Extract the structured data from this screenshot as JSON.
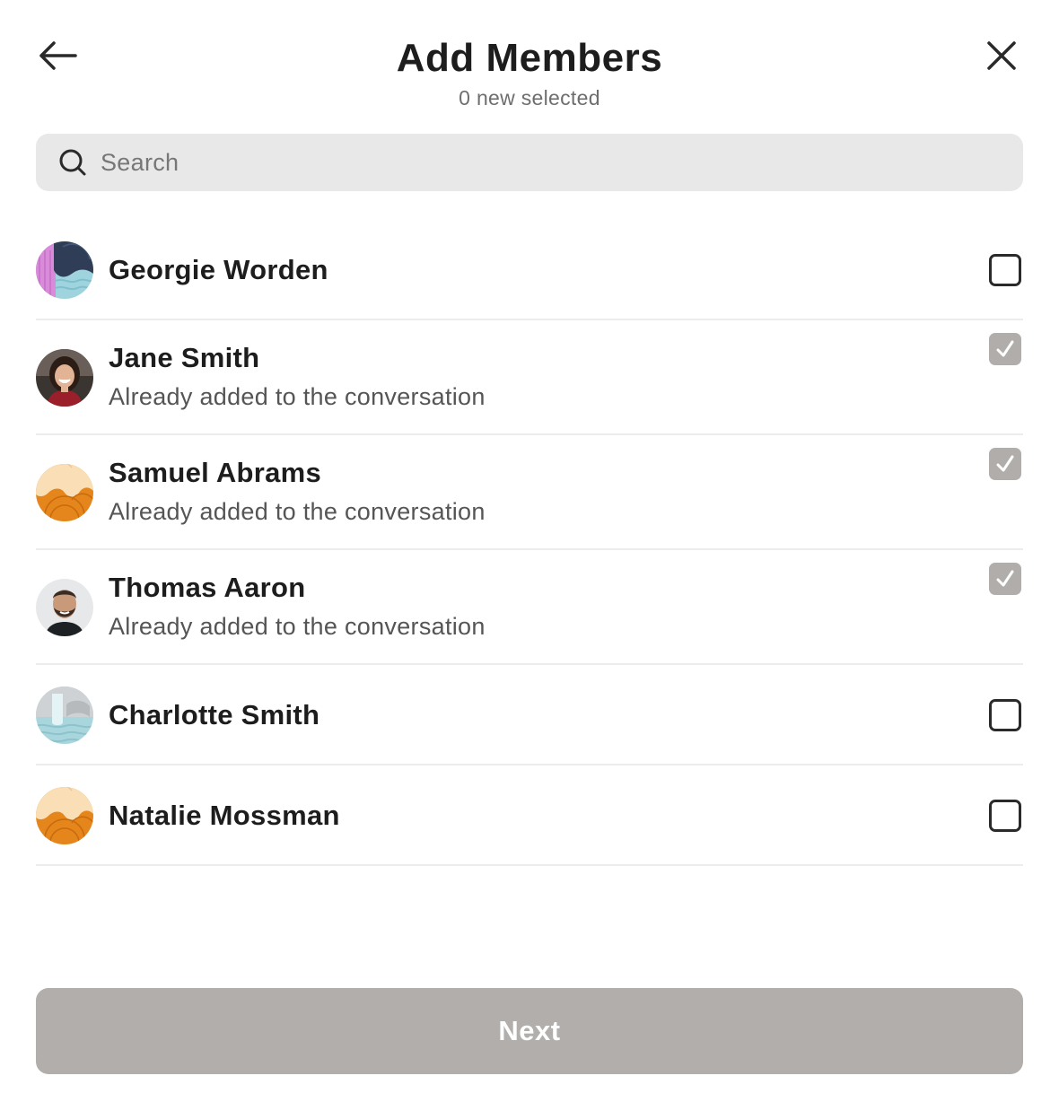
{
  "header": {
    "title": "Add Members",
    "subtitle": "0 new selected"
  },
  "search": {
    "placeholder": "Search",
    "value": ""
  },
  "members": [
    {
      "name": "Georgie Worden",
      "status": "",
      "checked": false,
      "disabled": false,
      "avatar": "pattern-pink-navy"
    },
    {
      "name": "Jane Smith",
      "status": "Already added to the conversation",
      "checked": true,
      "disabled": true,
      "avatar": "photo-woman"
    },
    {
      "name": "Samuel Abrams",
      "status": "Already added to the conversation",
      "checked": true,
      "disabled": true,
      "avatar": "pattern-orange"
    },
    {
      "name": "Thomas Aaron",
      "status": "Already added to the conversation",
      "checked": true,
      "disabled": true,
      "avatar": "photo-man"
    },
    {
      "name": "Charlotte Smith",
      "status": "",
      "checked": false,
      "disabled": false,
      "avatar": "pattern-light-blue"
    },
    {
      "name": "Natalie Mossman",
      "status": "",
      "checked": false,
      "disabled": false,
      "avatar": "pattern-orange"
    }
  ],
  "footer": {
    "next_label": "Next",
    "next_enabled": false
  },
  "colors": {
    "button_disabled": "#b1aeab",
    "checkbox_checked_disabled": "#b0adaa",
    "search_bg": "#e8e8e8",
    "divider": "#ececec"
  },
  "icons": {
    "back": "arrow-left-icon",
    "close": "close-icon",
    "search": "search-icon",
    "check": "checkmark-icon"
  }
}
